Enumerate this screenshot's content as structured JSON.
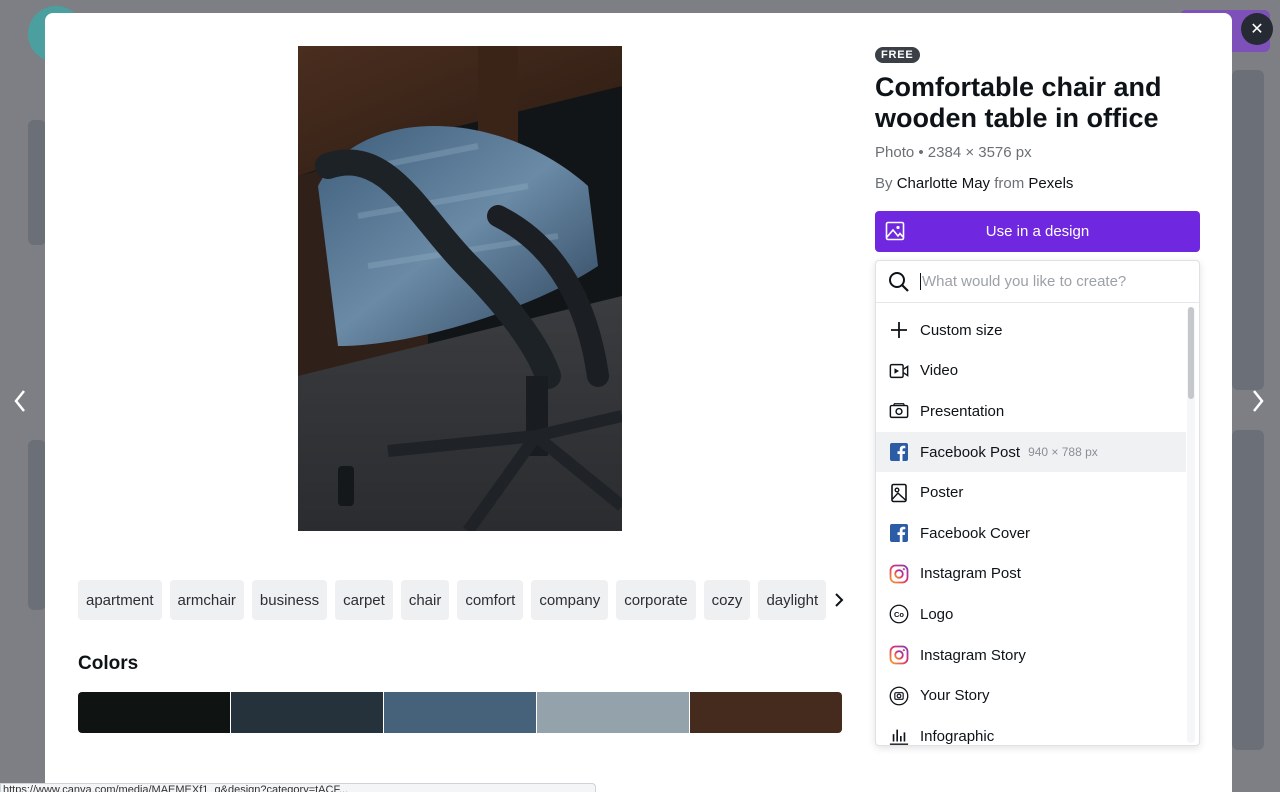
{
  "badge": "FREE",
  "title": "Comfortable chair and wooden table in office",
  "meta": "Photo • 2384 × 3576 px",
  "credit": {
    "by": "By",
    "author": "Charlotte May",
    "from": "from",
    "source": "Pexels"
  },
  "use_button": "Use in a design",
  "search": {
    "placeholder": "What would you like to create?"
  },
  "menu": [
    {
      "label": "Custom size",
      "icon": "plus-icon"
    },
    {
      "label": "Video",
      "icon": "video-icon"
    },
    {
      "label": "Presentation",
      "icon": "presentation-icon"
    },
    {
      "label": "Facebook Post",
      "icon": "facebook-icon",
      "dimensions": "940 × 788 px"
    },
    {
      "label": "Poster",
      "icon": "poster-icon"
    },
    {
      "label": "Facebook Cover",
      "icon": "facebook-icon"
    },
    {
      "label": "Instagram Post",
      "icon": "instagram-icon"
    },
    {
      "label": "Logo",
      "icon": "logo-icon"
    },
    {
      "label": "Instagram Story",
      "icon": "instagram-icon"
    },
    {
      "label": "Your Story",
      "icon": "story-icon"
    },
    {
      "label": "Infographic",
      "icon": "infographic-icon"
    }
  ],
  "tags": [
    "apartment",
    "armchair",
    "business",
    "carpet",
    "chair",
    "comfort",
    "company",
    "corporate",
    "cozy",
    "daylight"
  ],
  "colors_title": "Colors",
  "colors": [
    "#0f1413",
    "#25323b",
    "#46617a",
    "#94a2ab",
    "#452a1e"
  ],
  "accent": "#7027e0",
  "statusbar": "https://www.canva.com/media/MAEMEXf1_g&design?category=tACF..."
}
